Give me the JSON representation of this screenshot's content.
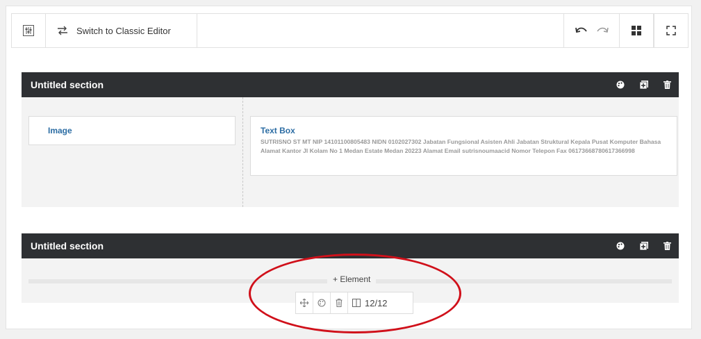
{
  "toolbar": {
    "switch_label": "Switch to Classic Editor"
  },
  "sections": [
    {
      "title": "Untitled section",
      "image_card": {
        "title": "Image"
      },
      "text_card": {
        "title": "Text Box",
        "body": "SUTRISNO ST MT NIP 14101100805483 NIDN 0102027302 Jabatan Fungsional Asisten Ahli Jabatan Struktural Kepala Pusat Komputer Bahasa Alamat Kantor Jl Kolam No 1 Medan Estate Medan 20223 Alamat Email sutrisnoumaacid Nomor Telepon Fax 06173668780617366998"
      }
    },
    {
      "title": "Untitled section",
      "add_element_label": "+ Element",
      "column_width_label": "12/12"
    }
  ],
  "colors": {
    "section_bar": "#2e3033",
    "link_blue": "#2b6ca3",
    "annotation_red": "#d0101a"
  }
}
